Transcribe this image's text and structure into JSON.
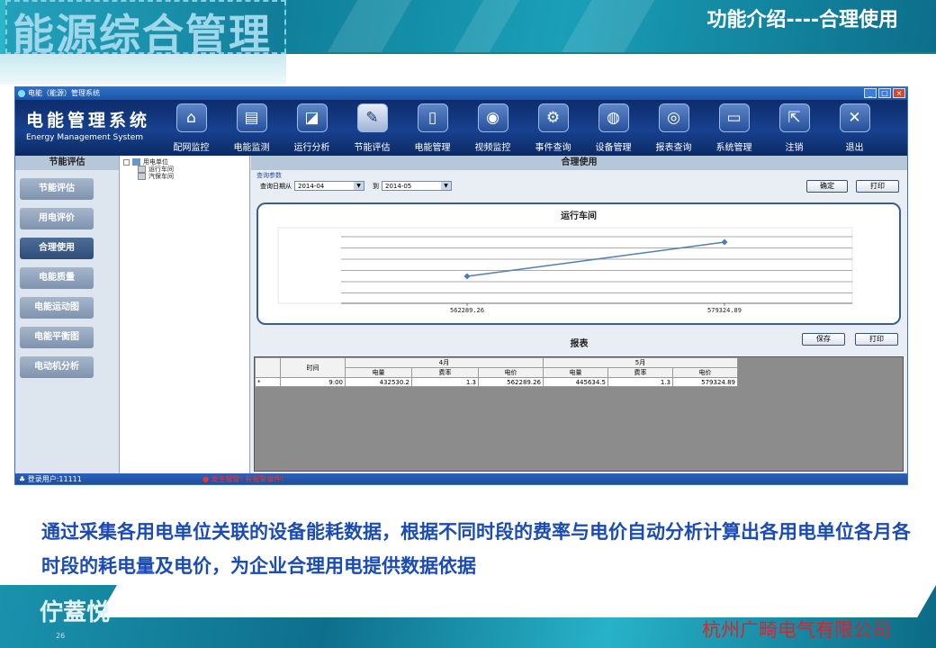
{
  "slide": {
    "header_title": "能源综合管理",
    "header_right": "功能介绍----合理使用",
    "description": "通过采集各用电单位关联的设备能耗数据，根据不同时段的费率与电价自动分析计算出各用电单位各月各时段的耗电量及电价，为企业合理用电提供数据依据",
    "footer_ghost": "佇蓋悦",
    "page_number": "26",
    "company": "杭州广畸电气有限公司"
  },
  "window": {
    "title": "电能（能源）管理系统",
    "brand_cn": "电能管理系统",
    "brand_en": "Energy Management System",
    "tools": [
      {
        "label": "配网监控",
        "icon": "home-icon",
        "glyph": "⌂"
      },
      {
        "label": "电能监测",
        "icon": "meter-icon",
        "glyph": "▤"
      },
      {
        "label": "运行分析",
        "icon": "chart-icon",
        "glyph": "◪"
      },
      {
        "label": "节能评估",
        "icon": "notebook-icon",
        "glyph": "✎"
      },
      {
        "label": "电能管理",
        "icon": "battery-icon",
        "glyph": "▯"
      },
      {
        "label": "视频监控",
        "icon": "camera-icon",
        "glyph": "◉"
      },
      {
        "label": "事件查询",
        "icon": "event-icon",
        "glyph": "⚙"
      },
      {
        "label": "设备管理",
        "icon": "device-icon",
        "glyph": "◍"
      },
      {
        "label": "报表查询",
        "icon": "report-icon",
        "glyph": "◎"
      },
      {
        "label": "系统管理",
        "icon": "folder-icon",
        "glyph": "▭"
      },
      {
        "label": "注销",
        "icon": "logout-icon",
        "glyph": "⇱"
      },
      {
        "label": "退出",
        "icon": "exit-icon",
        "glyph": "✕"
      }
    ],
    "active_tool": "节能评估",
    "left_header": "节能评估",
    "left_buttons": [
      "节能评估",
      "用电评价",
      "合理使用",
      "电能质量",
      "电能运动图",
      "电能平衡图",
      "电动机分析"
    ],
    "active_left": "合理使用",
    "tree": {
      "root": "用电单位",
      "children": [
        "运行车间",
        "汽保车间"
      ]
    },
    "main_header": "合理使用",
    "query_params_label": "查询参数",
    "query_from_label": "查询日期从",
    "query_from": "2014-04",
    "query_to_label": "到",
    "query_to": "2014-05",
    "confirm_label": "确定",
    "print_label": "打印",
    "report_title": "报表",
    "save_label": "保存",
    "report_print_label": "打印",
    "status_user": "登录用户:11111",
    "status_warning": "发生报警!  有报警事件!"
  },
  "chart_data": {
    "type": "line",
    "title": "运行车间",
    "categories": [
      "562289.26",
      "579324.89"
    ],
    "series": [
      {
        "values": [
          562289.26,
          579324.89
        ]
      }
    ]
  },
  "table": {
    "time_header": "时间",
    "months": [
      "4月",
      "5月"
    ],
    "sub_headers": [
      "电量",
      "费率",
      "电价",
      "电量",
      "费率",
      "电价"
    ],
    "rows": [
      {
        "marker": "*",
        "time": "9:00",
        "cells": [
          "432530.2",
          "1.3",
          "562289.26",
          "445634.5",
          "1.3",
          "579324.89"
        ]
      }
    ]
  },
  "colors": {
    "accent": "#1b4bb4",
    "company": "#d8252b",
    "toolbar": "#17418f"
  }
}
